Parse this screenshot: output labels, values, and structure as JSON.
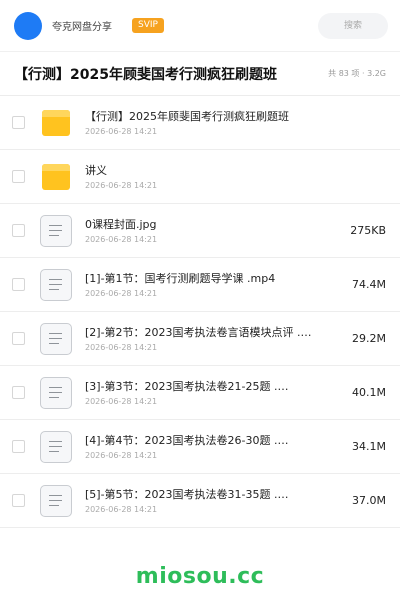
{
  "header": {
    "app_name": "夸克网盘分享",
    "badge": "SVIP",
    "search_placeholder": "搜索",
    "colors": {
      "avatar": "#1e7bf5",
      "badge": "#f6a21f"
    }
  },
  "share": {
    "title": "【行测】2025年顾斐国考行测疯狂刷题班",
    "meta": "共 83 项 · 3.2G"
  },
  "files": [
    {
      "type": "folder",
      "name": "【行测】2025年顾斐国考行测疯狂刷题班",
      "date": "2026-06-28 14:21",
      "size": ""
    },
    {
      "type": "folder",
      "name": "讲义",
      "date": "2026-06-28 14:21",
      "size": ""
    },
    {
      "type": "file",
      "name": "0课程封面.jpg",
      "date": "2026-06-28 14:21",
      "size": "275KB"
    },
    {
      "type": "file",
      "name": "[1]-第1节：国考行测刷题导学课 .mp4",
      "date": "2026-06-28 14:21",
      "size": "74.4M"
    },
    {
      "type": "file",
      "name": "[2]-第2节：2023国考执法卷言语模块点评 .…",
      "date": "2026-06-28 14:21",
      "size": "29.2M"
    },
    {
      "type": "file",
      "name": "[3]-第3节：2023国考执法卷21-25题 .…",
      "date": "2026-06-28 14:21",
      "size": "40.1M"
    },
    {
      "type": "file",
      "name": "[4]-第4节：2023国考执法卷26-30题 .…",
      "date": "2026-06-28 14:21",
      "size": "34.1M"
    },
    {
      "type": "file",
      "name": "[5]-第5节：2023国考执法卷31-35题 .…",
      "date": "2026-06-28 14:21",
      "size": "37.0M"
    }
  ],
  "icons": {
    "folder": "folder-icon",
    "file": "file-icon"
  },
  "watermark": "miosou.cc"
}
